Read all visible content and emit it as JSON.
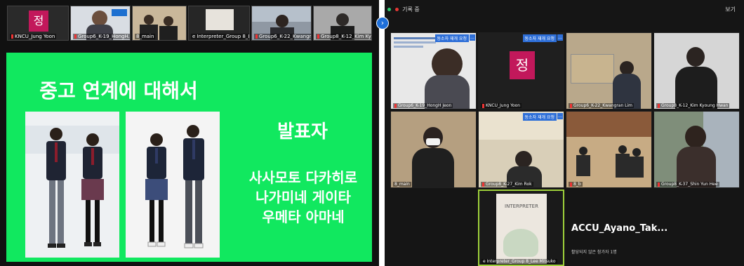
{
  "left": {
    "strip": [
      {
        "name": "KNCU_Jung Yoon",
        "avatar": "정"
      },
      {
        "name": "Group6_K-19_HongH..."
      },
      {
        "name": "8_main"
      },
      {
        "name": "e Interpreter_Group 8_Le..."
      },
      {
        "name": "Group6_K-22_Kwangran..."
      },
      {
        "name": "Group8_K-12_Kim Kyo..."
      }
    ],
    "slide": {
      "title": "중고 연계에 대해서",
      "presenter_label": "발표자",
      "presenters": [
        "사사모토 다카히로",
        "나가미네 게이타",
        "우메타 아마네"
      ]
    }
  },
  "right": {
    "top_bar": {
      "record_label": "기록 중",
      "top_right": "보기"
    },
    "caption_button": "동소자 재개 요청",
    "tiles": [
      {
        "name": "Group6_K-19_HongH Jeon"
      },
      {
        "name": "KNCU_Jung Yoon",
        "avatar": "정"
      },
      {
        "name": "Group6_K-22_Kwangran Lim"
      },
      {
        "name": "Group8_K-12_Kim Kyoung Hwan"
      },
      {
        "name": "8_main"
      },
      {
        "name": "Group8_K-27_Kim Rok"
      },
      {
        "name": "8_b"
      },
      {
        "name": "Group8_K-37_Shin Yun Hee"
      },
      {
        "name": "e Interpreter_Group 8_Lee Mitsuko"
      }
    ],
    "interpreter_text": "INTERPRETER",
    "active_speaker": "ACCU_Ayano_Tak...",
    "active_sub": "활당되지 않은 참가자 1명"
  }
}
